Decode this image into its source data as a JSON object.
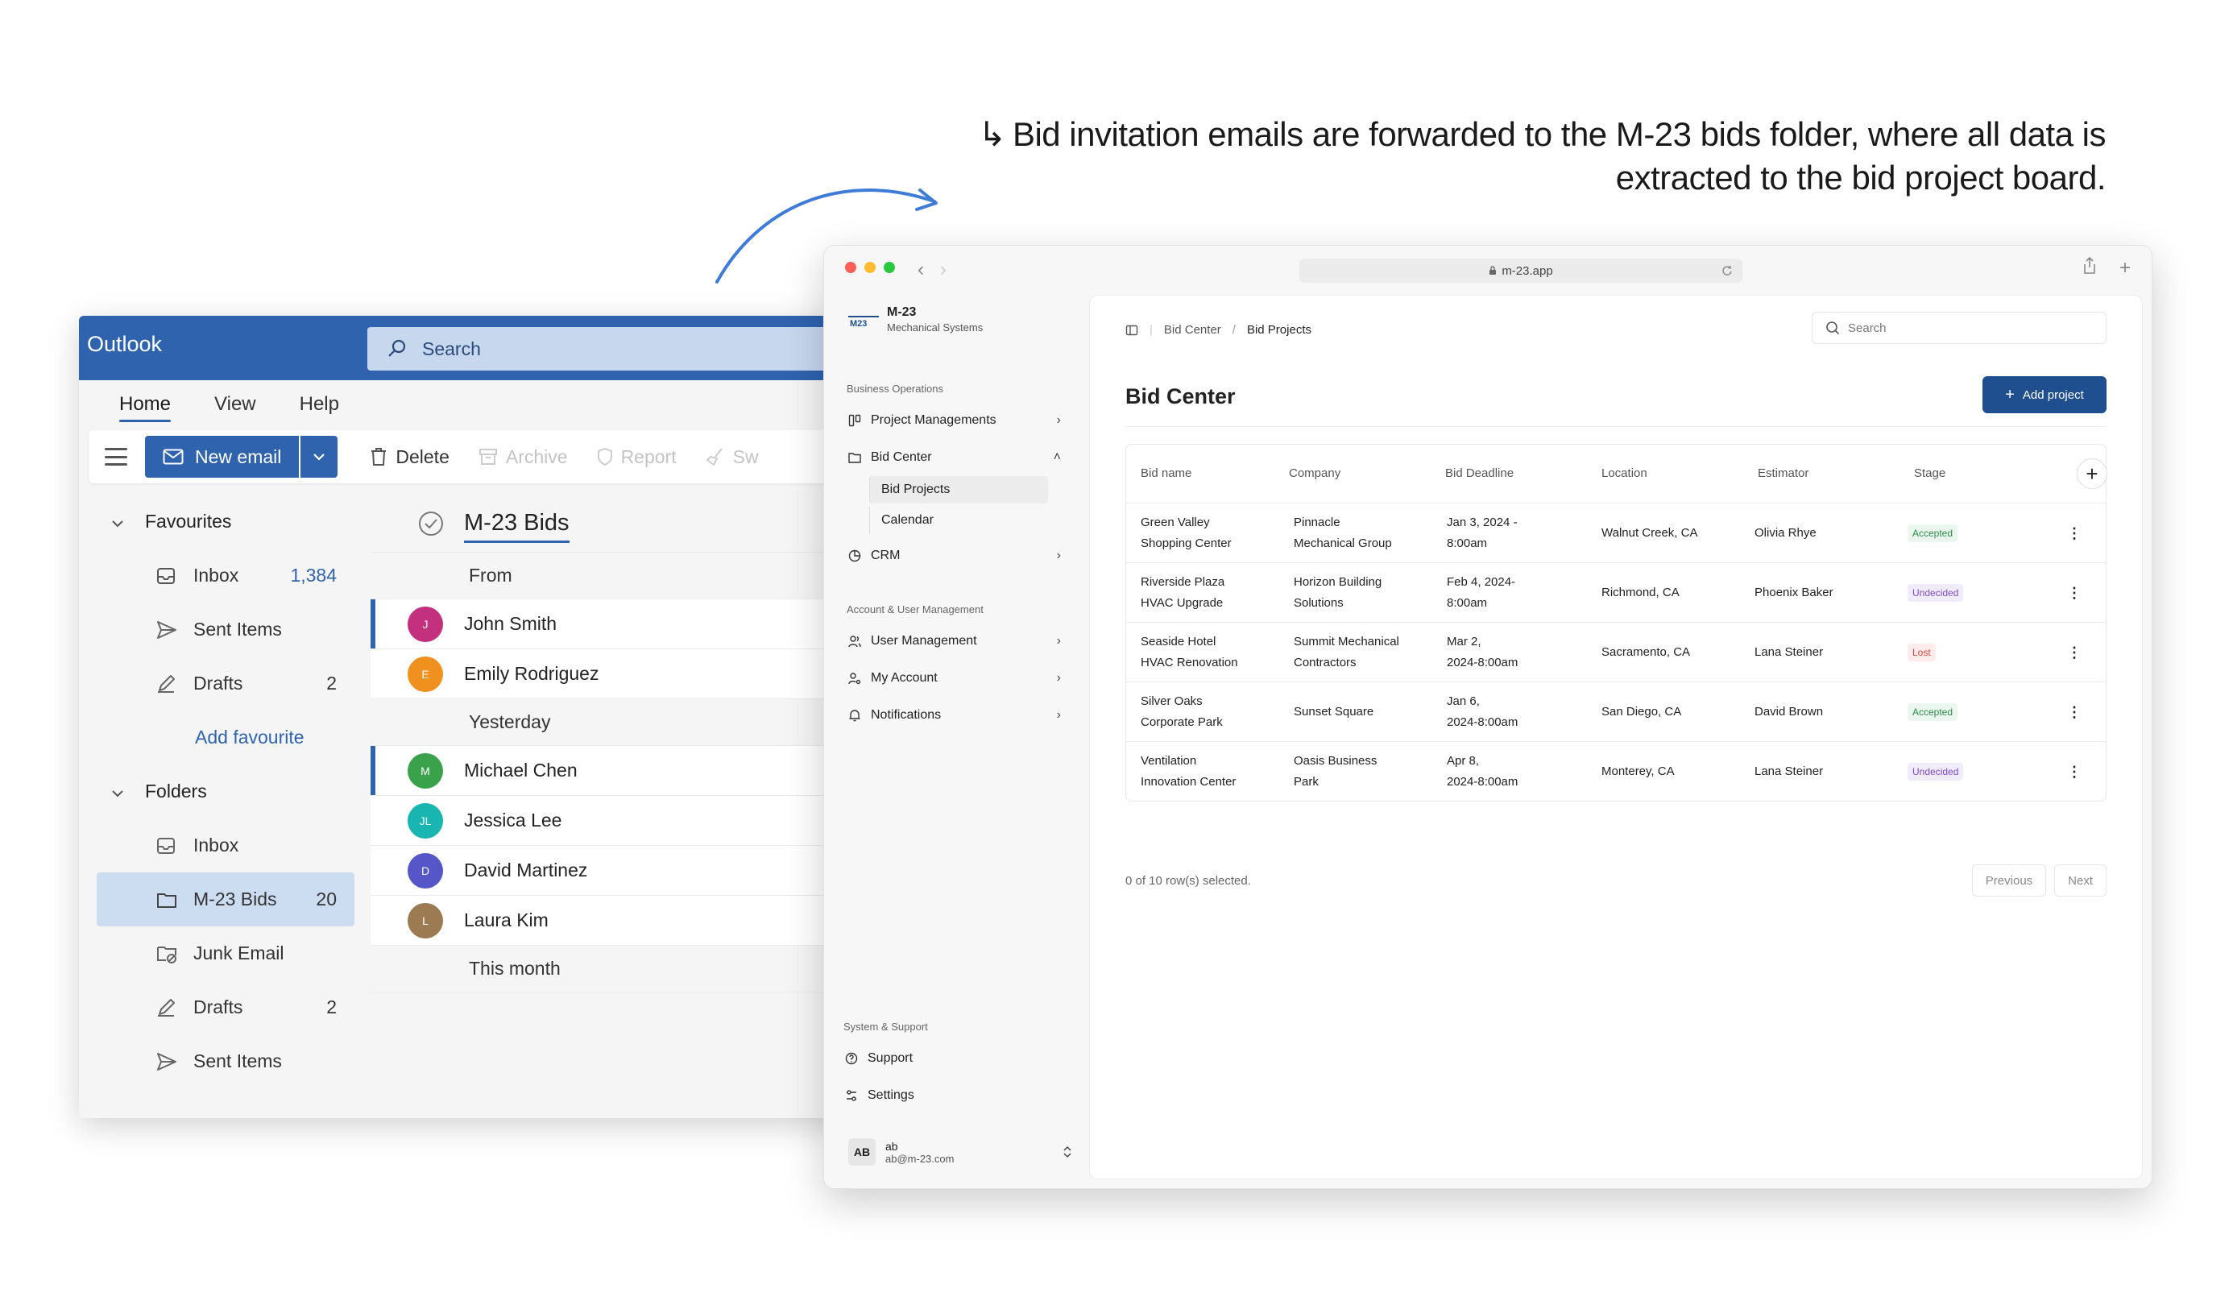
{
  "headline": {
    "hook": "↳",
    "line1": "Bid invitation emails are forwarded to the M-23 bids folder, where all data is",
    "line2": "extracted to the bid project board."
  },
  "outlook": {
    "brand": "Outlook",
    "search_placeholder": "Search",
    "tabs": [
      "Home",
      "View",
      "Help"
    ],
    "new_email": "New email",
    "toolbar": [
      "Delete",
      "Archive",
      "Report",
      "Sw"
    ],
    "nav": {
      "favourites": "Favourites",
      "fav_items": [
        {
          "label": "Inbox",
          "count": "1,384"
        },
        {
          "label": "Sent Items",
          "count": ""
        },
        {
          "label": "Drafts",
          "count": "2"
        }
      ],
      "add_favourite": "Add favourite",
      "folders": "Folders",
      "folder_items": [
        {
          "label": "Inbox",
          "count": ""
        },
        {
          "label": "M-23 Bids",
          "count": "20"
        },
        {
          "label": "Junk Email",
          "count": ""
        },
        {
          "label": "Drafts",
          "count": "2"
        },
        {
          "label": "Sent Items",
          "count": ""
        }
      ]
    },
    "list": {
      "folder_title": "M-23 Bids",
      "groups": [
        "From",
        "Yesterday",
        "This month"
      ],
      "messages": [
        {
          "initial": "J",
          "name": "John Smith",
          "color": "#c2307e"
        },
        {
          "initial": "E",
          "name": "Emily Rodriguez",
          "color": "#f0901f"
        },
        {
          "initial": "M",
          "name": "Michael Chen",
          "color": "#3aa24a"
        },
        {
          "initial": "JL",
          "name": "Jessica Lee",
          "color": "#19b5b0"
        },
        {
          "initial": "D",
          "name": "David Martinez",
          "color": "#5656c8"
        },
        {
          "initial": "L",
          "name": "Laura Kim",
          "color": "#9c7a52"
        }
      ]
    }
  },
  "app": {
    "url": "m-23.app",
    "brand_name": "M-23",
    "brand_sub": "Mechanical Systems",
    "sections": {
      "business": "Business Operations",
      "account": "Account & User Management",
      "system": "System & Support"
    },
    "nav": {
      "project_managements": "Project Managements",
      "bid_center": "Bid Center",
      "bid_projects": "Bid Projects",
      "calendar": "Calendar",
      "crm": "CRM",
      "user_management": "User Management",
      "my_account": "My Account",
      "notifications": "Notifications",
      "support": "Support",
      "settings": "Settings"
    },
    "user": {
      "initials": "AB",
      "name": "ab",
      "email": "ab@m-23.com"
    },
    "breadcrumb": [
      "Bid Center",
      "Bid Projects"
    ],
    "search_placeholder": "Search",
    "page_title": "Bid Center",
    "add_button": "Add project",
    "table": {
      "headers": [
        "Bid name",
        "Company",
        "Bid Deadline",
        "Location",
        "Estimator",
        "Stage"
      ],
      "rows": [
        {
          "name": [
            "Green Valley",
            "Shopping Center"
          ],
          "company": [
            "Pinnacle",
            "Mechanical Group"
          ],
          "deadline": [
            "Jan 3, 2024 -",
            "8:00am"
          ],
          "location": "Walnut Creek, CA",
          "estimator": "Olivia Rhye",
          "stage": "Accepted"
        },
        {
          "name": [
            "Riverside Plaza",
            "HVAC Upgrade"
          ],
          "company": [
            "Horizon Building",
            "Solutions"
          ],
          "deadline": [
            "Feb 4, 2024-",
            "8:00am"
          ],
          "location": "Richmond, CA",
          "estimator": "Phoenix Baker",
          "stage": "Undecided"
        },
        {
          "name": [
            "Seaside Hotel",
            "HVAC Renovation"
          ],
          "company": [
            "Summit Mechanical",
            "Contractors"
          ],
          "deadline": [
            "Mar 2,",
            "2024-8:00am"
          ],
          "location": "Sacramento, CA",
          "estimator": "Lana Steiner",
          "stage": "Lost"
        },
        {
          "name": [
            "Silver Oaks",
            "Corporate Park"
          ],
          "company": [
            "Sunset Square",
            ""
          ],
          "deadline": [
            "Jan 6,",
            "2024-8:00am"
          ],
          "location": "San Diego, CA",
          "estimator": "David Brown",
          "stage": "Accepted"
        },
        {
          "name": [
            "Ventilation",
            "Innovation Center"
          ],
          "company": [
            "Oasis Business",
            "Park"
          ],
          "deadline": [
            "Apr 8,",
            "2024-8:00am"
          ],
          "location": "Monterey, CA",
          "estimator": "Lana Steiner",
          "stage": "Undecided"
        }
      ]
    },
    "selection": "0 of 10 row(s) selected.",
    "pager": {
      "prev": "Previous",
      "next": "Next"
    }
  }
}
